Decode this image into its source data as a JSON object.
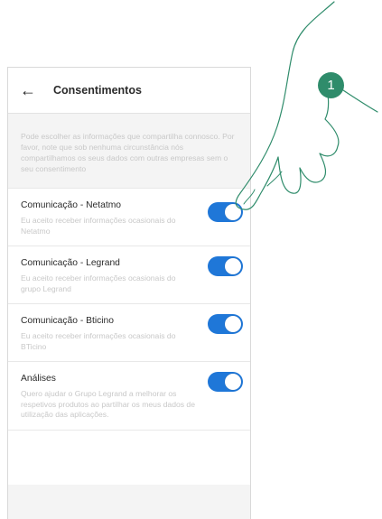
{
  "header": {
    "title": "Consentimentos",
    "back_icon": "arrow-left-icon"
  },
  "intro_text": "Pode escolher as informações que compartilha connosco. Por favor, note que sob nenhuma circunstância nós compartilhamos os seus dados com outras empresas sem o seu consentimento",
  "consents": [
    {
      "title": "Comunicação - Netatmo",
      "description": "Eu aceito receber informações ocasionais do Netatmo",
      "enabled": true
    },
    {
      "title": "Comunicação - Legrand",
      "description": "Eu aceito receber informações ocasionais do grupo Legrand",
      "enabled": true
    },
    {
      "title": "Comunicação - Bticino",
      "description": "Eu aceito receber informações ocasionais do BTicino",
      "enabled": true
    },
    {
      "title": "Análises",
      "description": "Quero ajudar o Grupo Legrand a melhorar os respetivos produtos ao partilhar os meus dados de utilização das aplicações.",
      "enabled": true
    }
  ],
  "annotation": {
    "step_number": "1"
  },
  "colors": {
    "toggle_on": "#1f77d8",
    "step_badge": "#2f8c6b"
  }
}
